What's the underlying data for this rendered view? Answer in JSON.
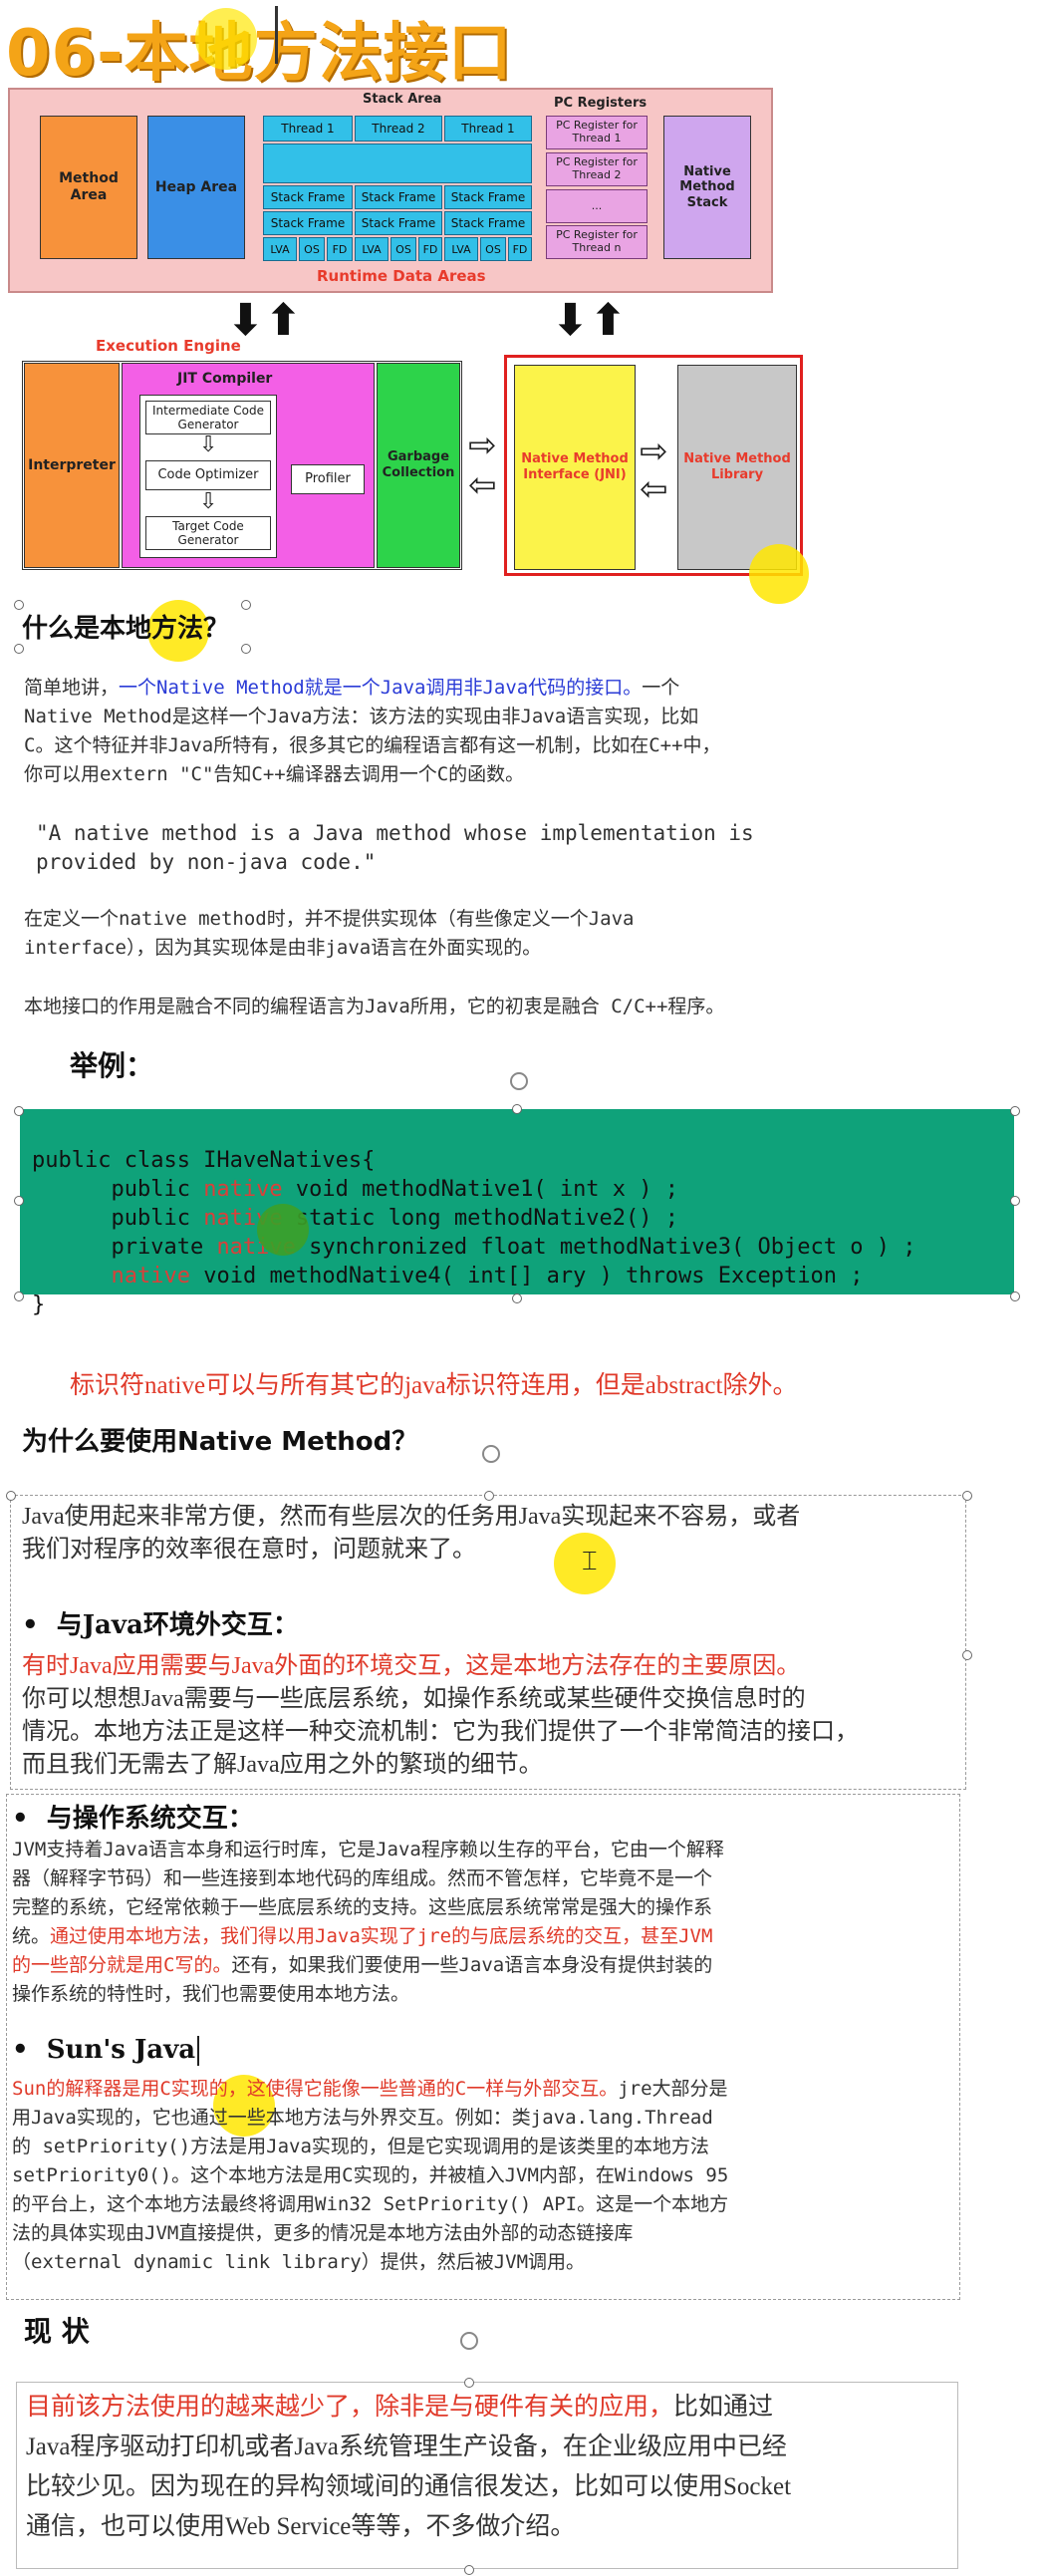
{
  "title": "06-本地方法接口",
  "diagram": {
    "stack_area_label": "Stack Area",
    "pc_registers_label": "PC Registers",
    "runtime_label": "Runtime Data Areas",
    "method_area": "Method Area",
    "heap_area": "Heap Area",
    "threads": [
      "Thread 1",
      "Thread 2",
      "Thread 1"
    ],
    "stack_frame": "Stack Frame",
    "lva": "LVA",
    "os": "OS",
    "fd": "FD",
    "pc_regs": [
      "PC Register for Thread 1",
      "PC Register for Thread 2",
      "...",
      "PC Register for Thread n"
    ],
    "native_method_stack": "Native Method Stack",
    "execution_engine_label": "Execution Engine",
    "interpreter": "Interpreter",
    "jit_compiler": "JIT Compiler",
    "intermediate_code": "Intermediate Code Generator",
    "code_optimizer": "Code Optimizer",
    "target_code": "Target Code Generator",
    "profiler": "Profiler",
    "garbage_collection": "Garbage Collection",
    "jni": "Native Method Interface (JNI)",
    "native_library": "Native Method Library",
    "colors": {
      "accent": "#f4a417",
      "code_bg": "#0fa27a",
      "red_text": "#e03a2a",
      "blue_text": "#2a3bd6"
    }
  },
  "section1": {
    "heading": "什么是本地方法？",
    "p1_plain1": "简单地讲，",
    "p1_blue": "一个Native Method就是一个Java调用非Java代码的接口。",
    "p1_plain2": "一个",
    "p1_line2": "Native Method是这样一个Java方法：该方法的实现由非Java语言实现，比如",
    "p1_line3": "C。这个特征并非Java所特有，很多其它的编程语言都有这一机制，比如在C++中，",
    "p1_line4": "你可以用extern \"C\"告知C++编译器去调用一个C的函数。",
    "quote_line1": "\"A native method is a Java method whose implementation is",
    "quote_line2": "provided by non-java code.\"",
    "p2_line1": "在定义一个native method时，并不提供实现体（有些像定义一个Java",
    "p2_line2": "interface），因为其实现体是由非java语言在外面实现的。",
    "p3": "本地接口的作用是融合不同的编程语言为Java所用，它的初衷是融合 C/C++程序。"
  },
  "example": {
    "heading": "举例：",
    "code_l1": "public class IHaveNatives{",
    "code_l2a": "      public ",
    "code_l2k": "native",
    "code_l2b": " void methodNative1( int x ) ;",
    "code_l3a": "      public ",
    "code_l3k": "native",
    "code_l3b": " static long methodNative2() ;",
    "code_l4a": "      private ",
    "code_l4k": "native",
    "code_l4b": " synchronized float methodNative3( Object o ) ;",
    "code_l5a": "      ",
    "code_l5k": "native",
    "code_l5b": " void methodNative4( int[] ary ) throws Exception ;",
    "code_l6": "}",
    "note": "标识符native可以与所有其它的java标识符连用，但是abstract除外。"
  },
  "section2": {
    "heading": "为什么要使用Native Method？",
    "intro_l1": "Java使用起来非常方便，然而有些层次的任务用Java实现起来不容易，或者",
    "intro_l2": "我们对程序的效率很在意时，问题就来了。",
    "b1_title": "与Java环境外交互：",
    "b1_red": "有时Java应用需要与Java外面的环境交互，这是本地方法存在的主要原因。",
    "b1_l2": "你可以想想Java需要与一些底层系统，如操作系统或某些硬件交换信息时的",
    "b1_l3": "情况。本地方法正是这样一种交流机制：它为我们提供了一个非常简洁的接口，",
    "b1_l4": "而且我们无需去了解Java应用之外的繁琐的细节。",
    "b2_title": "与操作系统交互：",
    "b2_l1": "JVM支持着Java语言本身和运行时库，它是Java程序赖以生存的平台，它由一个解释",
    "b2_l2": "器（解释字节码）和一些连接到本地代码的库组成。然而不管怎样，它毕竟不是一个",
    "b2_l3": "完整的系统，它经常依赖于一些底层系统的支持。这些底层系统常常是强大的操作系",
    "b2_l4a": "统。",
    "b2_l4r": "通过使用本地方法，我们得以用Java实现了jre的与底层系统的交互，甚至JVM",
    "b2_l5r": "的一些部分就是用C写的。",
    "b2_l5b": "还有，如果我们要使用一些Java语言本身没有提供封装的",
    "b2_l6": "操作系统的特性时，我们也需要使用本地方法。",
    "b3_title": "Sun's Java",
    "b3_l1r": "Sun的解释器是用C实现的，这使得它能像一些普通的C一样与外部交互。",
    "b3_l1b": "jre大部分是",
    "b3_l2": "用Java实现的，它也通过一些本地方法与外界交互。例如：类java.lang.Thread",
    "b3_l3": "的 setPriority()方法是用Java实现的，但是它实现调用的是该类里的本地方法",
    "b3_l4": "setPriority0()。这个本地方法是用C实现的，并被植入JVM内部，在Windows 95",
    "b3_l5": "的平台上，这个本地方法最终将调用Win32 SetPriority() API。这是一个本地方",
    "b3_l6": "法的具体实现由JVM直接提供，更多的情况是本地方法由外部的动态链接库",
    "b3_l7": "（external dynamic link library）提供，然后被JVM调用。"
  },
  "section3": {
    "heading": "现 状",
    "l1r": "目前该方法使用的越来越少了，除非是与硬件有关的应用，",
    "l1b": "比如通过",
    "l2": "Java程序驱动打印机或者Java系统管理生产设备，在企业级应用中已经",
    "l3": "比较少见。因为现在的异构领域间的通信很发达，比如可以使用Socket",
    "l4": "通信，也可以使用Web Service等等，不多做介绍。"
  }
}
